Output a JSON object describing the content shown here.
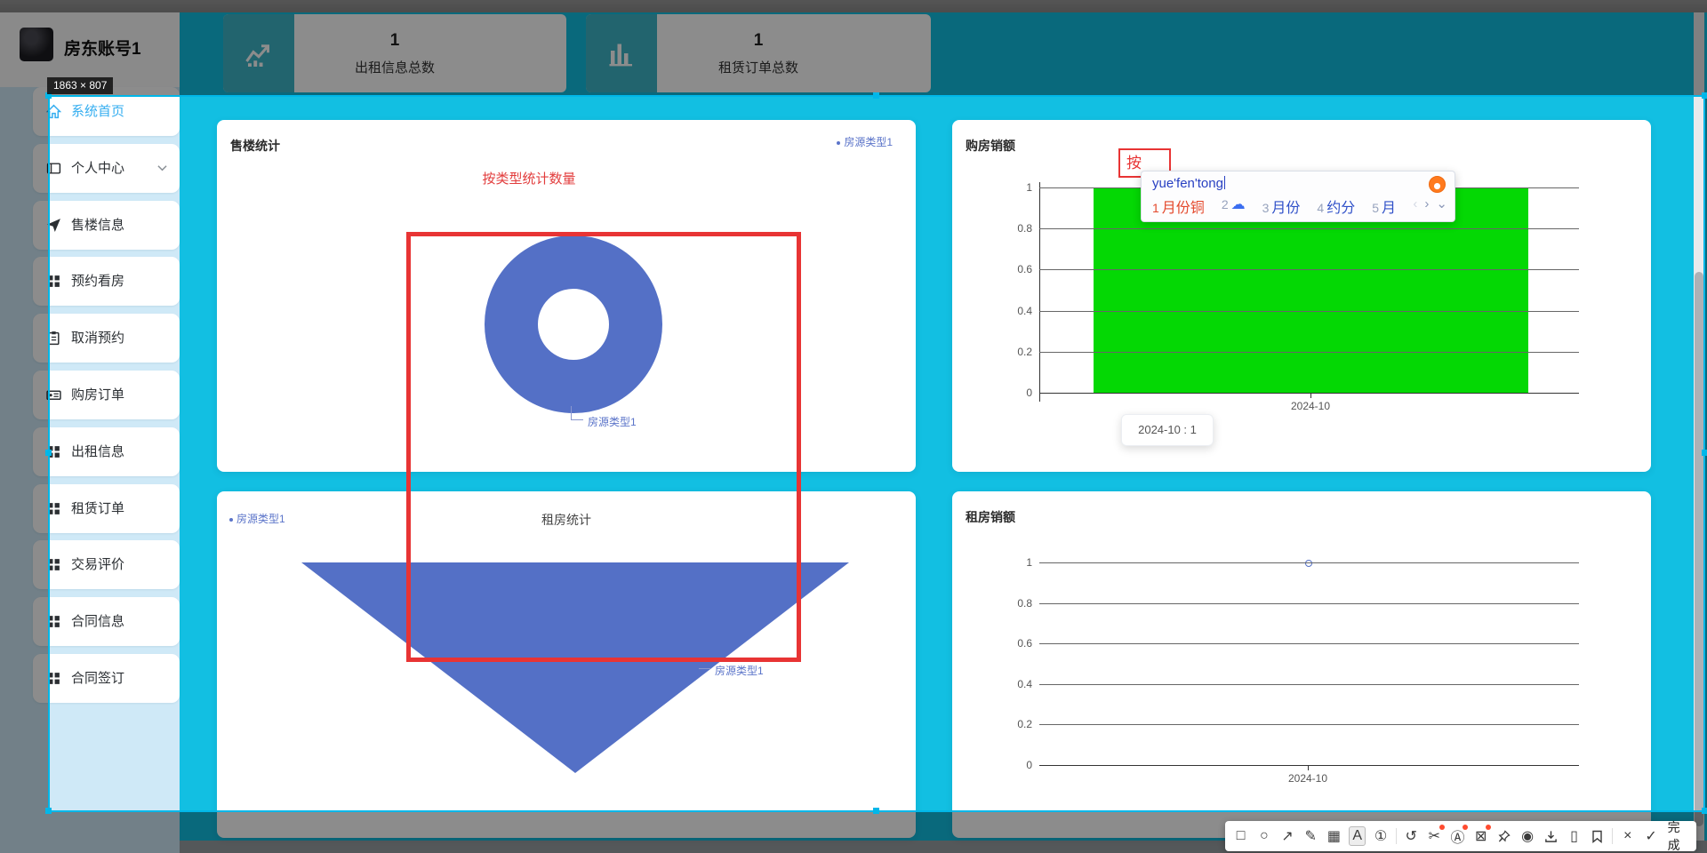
{
  "accent_colors": {
    "background_cyan": "#12bfe2",
    "selection_cyan": "#00b7e9",
    "series_blue": "#5470c6",
    "bar_green": "#04d804",
    "annotation_red": "#e83434",
    "active_menu_blue": "#35aef0"
  },
  "sidebar": {
    "username": "房东账号1",
    "items": [
      {
        "label": "系统首页",
        "icon": "home-icon",
        "active": true
      },
      {
        "label": "个人中心",
        "icon": "user-card-icon",
        "chevron": true
      },
      {
        "label": "售楼信息",
        "icon": "send-icon"
      },
      {
        "label": "预约看房",
        "icon": "grid-icon"
      },
      {
        "label": "取消预约",
        "icon": "clipboard-icon"
      },
      {
        "label": "购房订单",
        "icon": "id-card-icon"
      },
      {
        "label": "出租信息",
        "icon": "grid-icon"
      },
      {
        "label": "租赁订单",
        "icon": "grid-icon"
      },
      {
        "label": "交易评价",
        "icon": "grid-icon"
      },
      {
        "label": "合同信息",
        "icon": "grid-icon"
      },
      {
        "label": "合同签订",
        "icon": "grid-icon"
      }
    ]
  },
  "stats": [
    {
      "value": "1",
      "label": "出租信息总数",
      "icon": "line-chart-icon"
    },
    {
      "value": "1",
      "label": "租赁订单总数",
      "icon": "bar-chart-icon"
    }
  ],
  "chart_data": [
    {
      "id": "sale_stats",
      "type": "pie",
      "shape": "donut",
      "title": "售楼统计",
      "categories": [
        "房源类型1"
      ],
      "values": [
        1
      ],
      "legend": [
        "房源类型1"
      ],
      "legend_position": "top-right",
      "color": "#5470c6"
    },
    {
      "id": "purchase_sales",
      "type": "bar",
      "title": "购房销额",
      "x": [
        "2024-10"
      ],
      "values": [
        1
      ],
      "ylim": [
        0,
        1
      ],
      "y_ticks": [
        "1",
        "0.8",
        "0.6",
        "0.4",
        "0.2",
        "0"
      ],
      "grid": true,
      "bar_color": "#04d804",
      "tooltip": "2024-10 : 1"
    },
    {
      "id": "rent_stats",
      "type": "funnel",
      "title": "租房统计",
      "categories": [
        "房源类型1"
      ],
      "values": [
        1
      ],
      "legend": [
        "房源类型1"
      ],
      "legend_position": "top-left",
      "color": "#5470c6"
    },
    {
      "id": "rent_sales",
      "type": "line",
      "title": "租房销额",
      "x": [
        "2024-10"
      ],
      "values": [
        1
      ],
      "ylim": [
        0,
        1
      ],
      "y_ticks": [
        "1",
        "0.8",
        "0.6",
        "0.4",
        "0.2",
        "0"
      ],
      "grid": true,
      "point_color": "#5470c6"
    }
  ],
  "screenshot_tool": {
    "size_badge": "1863 × 807",
    "annotations": {
      "completed_text": "按类型统计数量",
      "pending_text": "按"
    },
    "ime": {
      "pinyin": "yue'fen'tong",
      "candidates": [
        {
          "index": "1",
          "text": "月份铜",
          "highlight": true
        },
        {
          "index": "2",
          "text": "☁",
          "icon": "cloud-icon"
        },
        {
          "index": "3",
          "text": "月份"
        },
        {
          "index": "4",
          "text": "约分"
        },
        {
          "index": "5",
          "text": "月"
        }
      ],
      "pager": {
        "prev": "‹",
        "next": "›",
        "expand": "⌄"
      }
    },
    "toolbar": {
      "done_label": "完成",
      "tools": [
        {
          "name": "rectangle-tool",
          "glyph": "□"
        },
        {
          "name": "ellipse-tool",
          "glyph": "○"
        },
        {
          "name": "arrow-tool",
          "glyph": "↗"
        },
        {
          "name": "pen-tool",
          "glyph": "✎"
        },
        {
          "name": "mosaic-tool",
          "glyph": "▦"
        },
        {
          "name": "text-tool",
          "glyph": "A",
          "selected": true
        },
        {
          "name": "number-stamp-tool",
          "glyph": "①"
        },
        {
          "name": "separator"
        },
        {
          "name": "undo-tool",
          "glyph": "↺"
        },
        {
          "name": "cut-tool",
          "glyph": "✂",
          "badge": true
        },
        {
          "name": "ocr-tool",
          "glyph": "Ⓐ",
          "badge": true
        },
        {
          "name": "extract-tool",
          "glyph": "⊠",
          "badge": true
        },
        {
          "name": "pin-tool",
          "glyph": "svg:pin"
        },
        {
          "name": "record-tool",
          "glyph": "◉"
        },
        {
          "name": "download-tool",
          "glyph": "svg:download"
        },
        {
          "name": "device-tool",
          "glyph": "▯"
        },
        {
          "name": "bookmark-tool",
          "glyph": "svg:bookmark"
        },
        {
          "name": "separator"
        },
        {
          "name": "cancel-button",
          "glyph": "×"
        },
        {
          "name": "confirm-button",
          "glyph": "✓",
          "has_label": true
        }
      ]
    }
  }
}
